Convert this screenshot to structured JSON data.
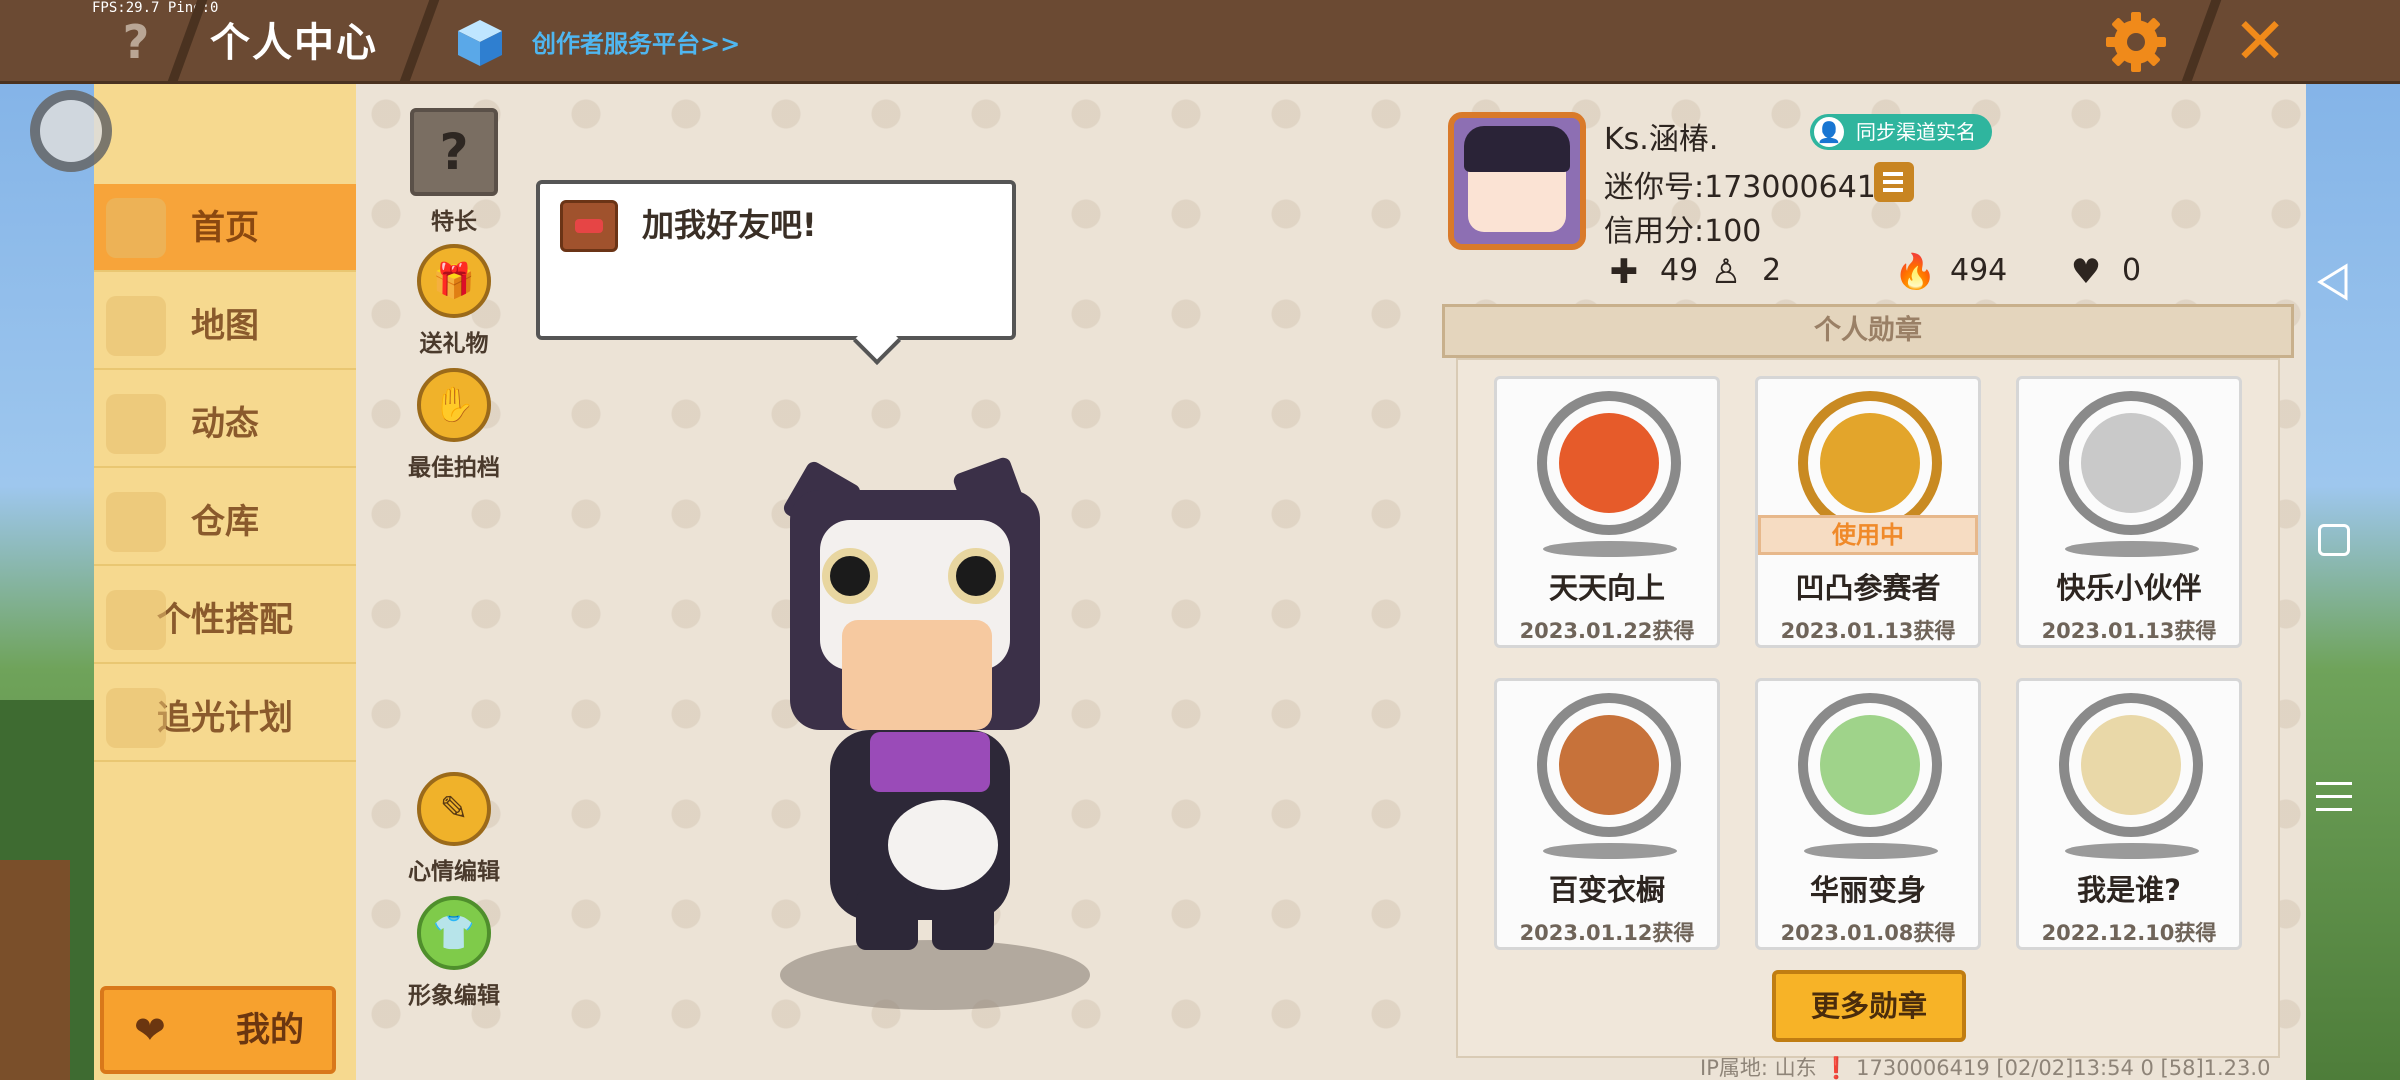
{
  "debug": {
    "fps": "FPS:29.7  Ping:0"
  },
  "header": {
    "help": "?",
    "title": "个人中心",
    "creator_link": "创作者服务平台>>",
    "close": "✕"
  },
  "sidebar": {
    "items": [
      {
        "label": "首页",
        "active": true
      },
      {
        "label": "地图"
      },
      {
        "label": "动态"
      },
      {
        "label": "仓库"
      },
      {
        "label": "个性搭配"
      },
      {
        "label": "追光计划"
      }
    ],
    "mine_button": "我的"
  },
  "actions": {
    "specialty": "特长",
    "gift": "送礼物",
    "partner": "最佳拍档",
    "mood_edit": "心情编辑",
    "image_edit": "形象编辑"
  },
  "bubble": {
    "text": "加我好友吧!"
  },
  "profile": {
    "name": "Ks.涵椿.",
    "sync_badge": "同步渠道实名",
    "mini_id": "迷你号:1730006419",
    "credit": "信用分:100",
    "stats": {
      "friends": "49",
      "fans": "2",
      "popularity": "494",
      "likes": "0"
    }
  },
  "medals": {
    "header": "个人勋章",
    "in_use_label": "使用中",
    "items": [
      {
        "name": "天天向上",
        "date": "2023.01.22获得",
        "color": "#e65b2a"
      },
      {
        "name": "凹凸参赛者",
        "date": "2023.01.13获得",
        "color": "#e3a52b",
        "in_use": true
      },
      {
        "name": "快乐小伙伴",
        "date": "2023.01.13获得",
        "color": "#c9c9c9"
      },
      {
        "name": "百变衣橱",
        "date": "2023.01.12获得",
        "color": "#c7723a"
      },
      {
        "name": "华丽变身",
        "date": "2023.01.08获得",
        "color": "#9fd38a"
      },
      {
        "name": "我是谁?",
        "date": "2022.12.10获得",
        "color": "#e9d8a8"
      }
    ],
    "more_button": "更多勋章"
  },
  "footer": {
    "text": "IP属地: 山东 ❗   1730006419    [02/02]13:54 0  [58]1.23.0"
  },
  "colors": {
    "accent": "#f7a43a",
    "topbar": "#6b4a33",
    "link": "#4fb6f0"
  }
}
